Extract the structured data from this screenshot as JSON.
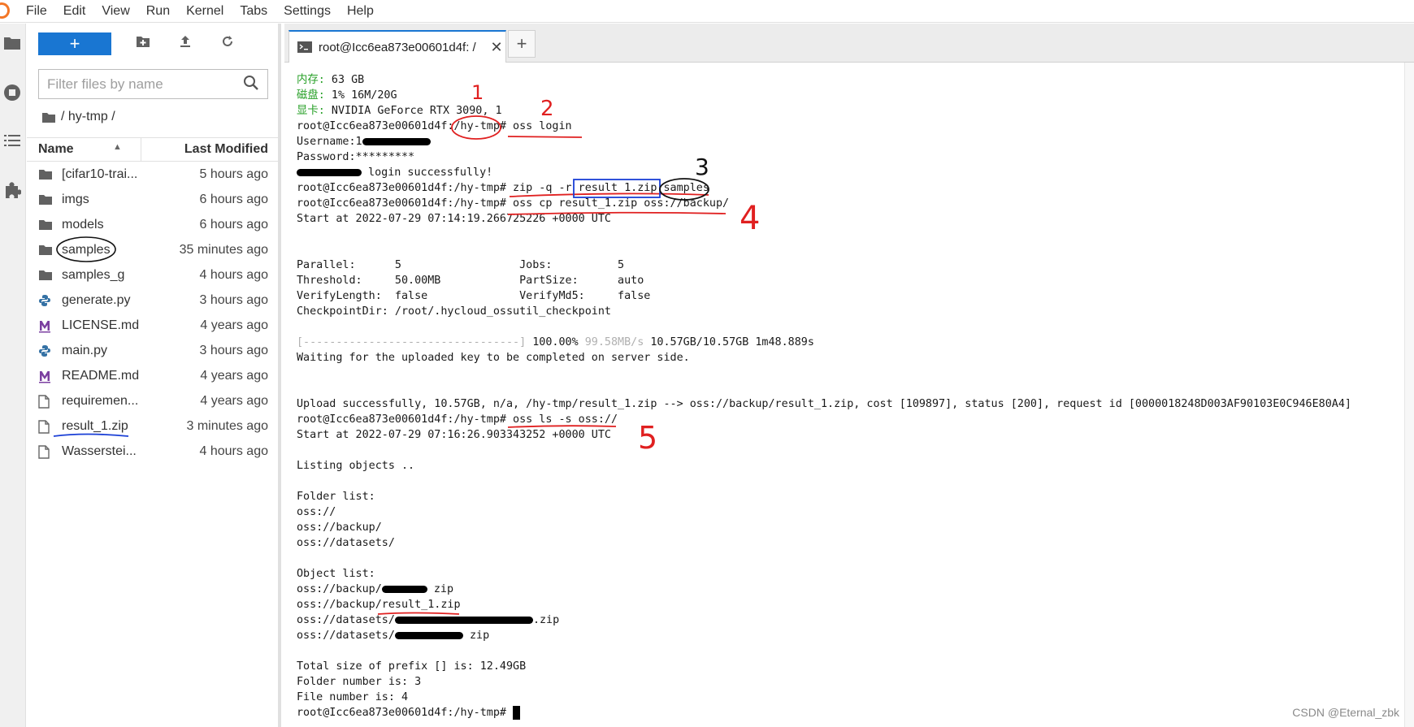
{
  "menu": [
    "File",
    "Edit",
    "View",
    "Run",
    "Kernel",
    "Tabs",
    "Settings",
    "Help"
  ],
  "filebrowser": {
    "new_label": "+",
    "filter_placeholder": "Filter files by name",
    "breadcrumb": "/ hy-tmp /",
    "col_name": "Name",
    "col_modified": "Last Modified",
    "files": [
      {
        "name": "[cifar10-trai...",
        "modified": "5 hours ago",
        "icon": "folder-icon"
      },
      {
        "name": "imgs",
        "modified": "6 hours ago",
        "icon": "folder-icon"
      },
      {
        "name": "models",
        "modified": "6 hours ago",
        "icon": "folder-icon"
      },
      {
        "name": "samples",
        "modified": "35 minutes ago",
        "icon": "folder-icon"
      },
      {
        "name": "samples_g",
        "modified": "4 hours ago",
        "icon": "folder-icon"
      },
      {
        "name": "generate.py",
        "modified": "3 hours ago",
        "icon": "python-icon"
      },
      {
        "name": "LICENSE.md",
        "modified": "4 years ago",
        "icon": "markdown-icon"
      },
      {
        "name": "main.py",
        "modified": "3 hours ago",
        "icon": "python-icon"
      },
      {
        "name": "README.md",
        "modified": "4 years ago",
        "icon": "markdown-icon"
      },
      {
        "name": "requiremen...",
        "modified": "4 years ago",
        "icon": "file-icon"
      },
      {
        "name": "result_1.zip",
        "modified": "3 minutes ago",
        "icon": "file-icon"
      },
      {
        "name": "Wasserstei...",
        "modified": "4 hours ago",
        "icon": "file-icon"
      }
    ]
  },
  "tab": {
    "label": "root@Icc6ea873e00601d4f: /"
  },
  "terminal": {
    "l1_label": "内存:",
    "l1_val": " 63 GB",
    "l2_label": "磁盘:",
    "l2_val": " 1% 16M/20G",
    "l3_label": "显卡:",
    "l3_val": " NVIDIA GeForce RTX 3090, 1",
    "l4": "root@Icc6ea873e00601d4f:/hy-tmp# oss login",
    "l5": "Username:1",
    "l6": "Password:*********",
    "l7": " login successfully!",
    "l8": "root@Icc6ea873e00601d4f:/hy-tmp# zip -q -r result_1.zip samples",
    "l9": "root@Icc6ea873e00601d4f:/hy-tmp# oss cp result_1.zip oss://backup/",
    "l10": "Start at 2022-07-29 07:14:19.266725226 +0000 UTC",
    "l11": "Parallel:      5                  Jobs:          5",
    "l12": "Threshold:     50.00MB            PartSize:      auto",
    "l13": "VerifyLength:  false              VerifyMd5:     false",
    "l14": "CheckpointDir: /root/.hycloud_ossutil_checkpoint",
    "l15_bar": "[---------------------------------]",
    "l15_pct": " 100.00% ",
    "l15_speed": "99.58MB/s",
    "l15_rest": " 10.57GB/10.57GB 1m48.889s",
    "l16": "Waiting for the uploaded key to be completed on server side.",
    "l17": "Upload successfully, 10.57GB, n/a, /hy-tmp/result_1.zip --> oss://backup/result_1.zip, cost [109897], status [200], request id [0000018248D003AF90103E0C946E80A4]",
    "l18": "root@Icc6ea873e00601d4f:/hy-tmp# oss ls -s oss://",
    "l19": "Start at 2022-07-29 07:16:26.903343252 +0000 UTC",
    "l20": "Listing objects ..",
    "l21": "Folder list:",
    "l22": "oss://",
    "l23": "oss://backup/",
    "l24": "oss://datasets/",
    "l25": "Object list:",
    "l26a": "oss://backup/",
    "l26b": " zip",
    "l27": "oss://backup/result_1.zip",
    "l28a": "oss://datasets/",
    "l28b": ".zip",
    "l29a": "oss://datasets/",
    "l29b": " zip",
    "l30": "Total size of prefix [] is: 12.49GB",
    "l31": "Folder number is: 3",
    "l32": "File number is: 4",
    "l33": "root@Icc6ea873e00601d4f:/hy-tmp# "
  },
  "annotations": {
    "n1": "1",
    "n2": "2",
    "n3": "3",
    "n4": "4",
    "n5": "5"
  },
  "watermark": "CSDN @Eternal_zbk"
}
